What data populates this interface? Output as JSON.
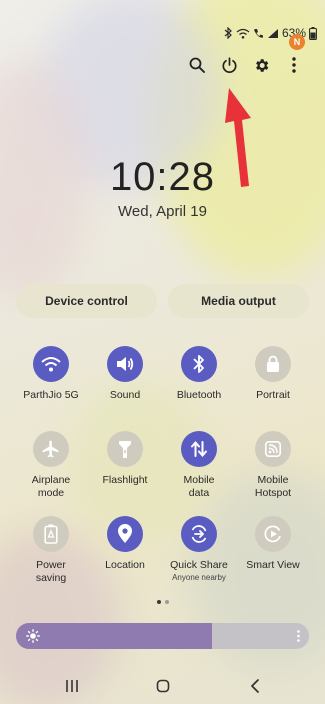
{
  "status_bar": {
    "battery_text": "63%",
    "icons": [
      "bluetooth-icon",
      "wifi-icon",
      "call-icon",
      "signal-icon",
      "battery-icon"
    ]
  },
  "top_actions": {
    "icons": [
      "search-icon",
      "power-icon",
      "gear-icon",
      "more-vert-icon"
    ],
    "notification_badge": "N"
  },
  "clock": {
    "time": "10:28",
    "date": "Wed, April 19"
  },
  "pills": {
    "device_control": "Device control",
    "media_output": "Media output"
  },
  "tiles": [
    {
      "label": "ParthJio 5G",
      "icon": "wifi-icon",
      "active": true
    },
    {
      "label": "Sound",
      "icon": "sound-icon",
      "active": true
    },
    {
      "label": "Bluetooth",
      "icon": "bluetooth-icon",
      "active": true
    },
    {
      "label": "Portrait",
      "icon": "portrait-lock-icon",
      "active": false
    },
    {
      "label": "Airplane\nmode",
      "label_1": "Airplane",
      "label_2": "mode",
      "icon": "airplane-icon",
      "active": false
    },
    {
      "label": "Flashlight",
      "icon": "flashlight-icon",
      "active": false
    },
    {
      "label_1": "Mobile",
      "label_2": "data",
      "icon": "mobile-data-icon",
      "active": true
    },
    {
      "label_1": "Mobile",
      "label_2": "Hotspot",
      "icon": "hotspot-icon",
      "active": false
    },
    {
      "label_1": "Power",
      "label_2": "saving",
      "icon": "power-saving-icon",
      "active": false
    },
    {
      "label": "Location",
      "icon": "location-icon",
      "active": true
    },
    {
      "label": "Quick Share",
      "sublabel": "Anyone nearby",
      "icon": "quick-share-icon",
      "active": true
    },
    {
      "label": "Smart View",
      "icon": "smart-view-icon",
      "active": false
    }
  ],
  "page_indicator": {
    "pages": 2,
    "current": 1
  },
  "brightness": {
    "level": 0.67,
    "icon": "sun-icon"
  },
  "colors": {
    "accent": "#5a5cc2",
    "inactive_tile": "#cfccbf",
    "brightness_fill": "#8f7bb0",
    "annotation_arrow": "#e8323a",
    "badge": "#e9842e"
  },
  "nav_bar": {
    "icons": [
      "recents-icon",
      "home-icon",
      "back-icon"
    ]
  }
}
